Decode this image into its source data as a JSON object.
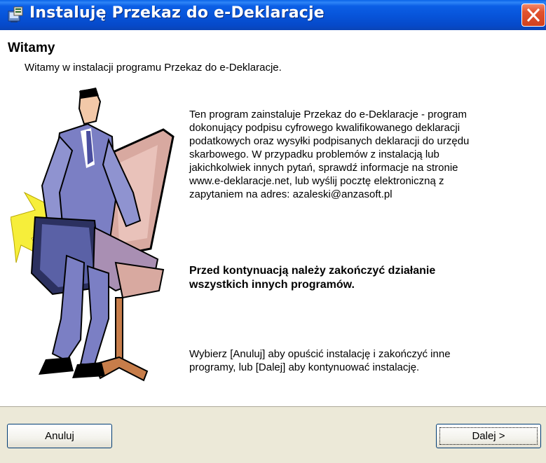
{
  "window": {
    "title": "Instaluję Przekaz do e-Deklaracje",
    "icon": "installer-icon",
    "close_icon": "close-icon",
    "titlebar_color": "#0753d8",
    "close_color": "#d1411e"
  },
  "header": {
    "title": "Witamy",
    "subtitle": "Witamy w instalacji programu Przekaz do e-Deklaracje."
  },
  "content": {
    "intro_lines": [
      "Ten program zainstaluje Przekaz do e-Deklaracje - program",
      "dokonujący podpisu cyfrowego kwalifikowanego deklaracji",
      "podatkowych oraz wysyłki podpisanych deklaracji do urzędu",
      "skarbowego. W przypadku problemów z instalacją lub",
      "jakichkolwiek innych pytań, sprawdź informacje na stronie",
      "www.e-deklaracje.net, lub wyślij pocztę elektroniczną z",
      "zapytaniem na adres: azaleski@anzasoft.pl"
    ],
    "warning_lines": [
      "Przed kontynuacją należy zakończyć działanie",
      "wszystkich innych programów."
    ],
    "instruction_lines": [
      "Wybierz [Anuluj] aby opuścić instalację i zakończyć inne",
      "programy, lub [Dalej] aby kontynuować instalację."
    ],
    "illustration": "businessman-with-laptop-clipart"
  },
  "buttons": {
    "cancel_label": "Anuluj",
    "next_label": "Dalej >"
  }
}
